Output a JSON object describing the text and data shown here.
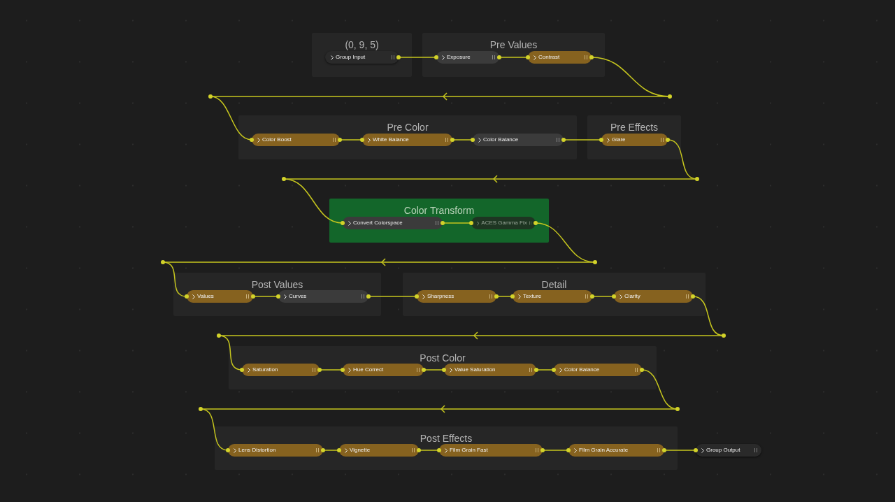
{
  "frames": [
    {
      "title": "(0, 9, 5)",
      "nodes": [
        {
          "label": "Group Input",
          "kind": "group"
        }
      ]
    },
    {
      "title": "Pre Values",
      "nodes": [
        {
          "label": "Exposure",
          "kind": "inactive"
        },
        {
          "label": "Contrast",
          "kind": "active"
        }
      ]
    },
    {
      "title": "Pre Color",
      "nodes": [
        {
          "label": "Color Boost",
          "kind": "active"
        },
        {
          "label": "White Balance",
          "kind": "active"
        },
        {
          "label": "Color Balance",
          "kind": "inactive"
        }
      ]
    },
    {
      "title": "Pre Effects",
      "nodes": [
        {
          "label": "Glare",
          "kind": "active"
        }
      ]
    },
    {
      "title": "Color Transform",
      "color": "#13662a",
      "nodes": [
        {
          "label": "Convert Colorspace",
          "kind": "inactive"
        },
        {
          "label": "ACES Gamma Fix",
          "kind": "muted"
        }
      ]
    },
    {
      "title": "Post Values",
      "nodes": [
        {
          "label": "Values",
          "kind": "active"
        },
        {
          "label": "Curves",
          "kind": "inactive"
        }
      ]
    },
    {
      "title": "Detail",
      "nodes": [
        {
          "label": "Sharpness",
          "kind": "active"
        },
        {
          "label": "Texture",
          "kind": "active"
        },
        {
          "label": "Clarity",
          "kind": "active"
        }
      ]
    },
    {
      "title": "Post Color",
      "nodes": [
        {
          "label": "Saturation",
          "kind": "active"
        },
        {
          "label": "Hue Correct",
          "kind": "active"
        },
        {
          "label": "Value Saturation",
          "kind": "active"
        },
        {
          "label": "Color Balance",
          "kind": "active"
        }
      ]
    },
    {
      "title": "Post Effects",
      "nodes": [
        {
          "label": "Lens Distortion",
          "kind": "active"
        },
        {
          "label": "Vignette",
          "kind": "active"
        },
        {
          "label": "Film Grain Fast",
          "kind": "active"
        },
        {
          "label": "Film Grain Accurate",
          "kind": "active"
        }
      ]
    }
  ],
  "loose_nodes": [
    {
      "label": "Group Output",
      "kind": "group"
    }
  ]
}
